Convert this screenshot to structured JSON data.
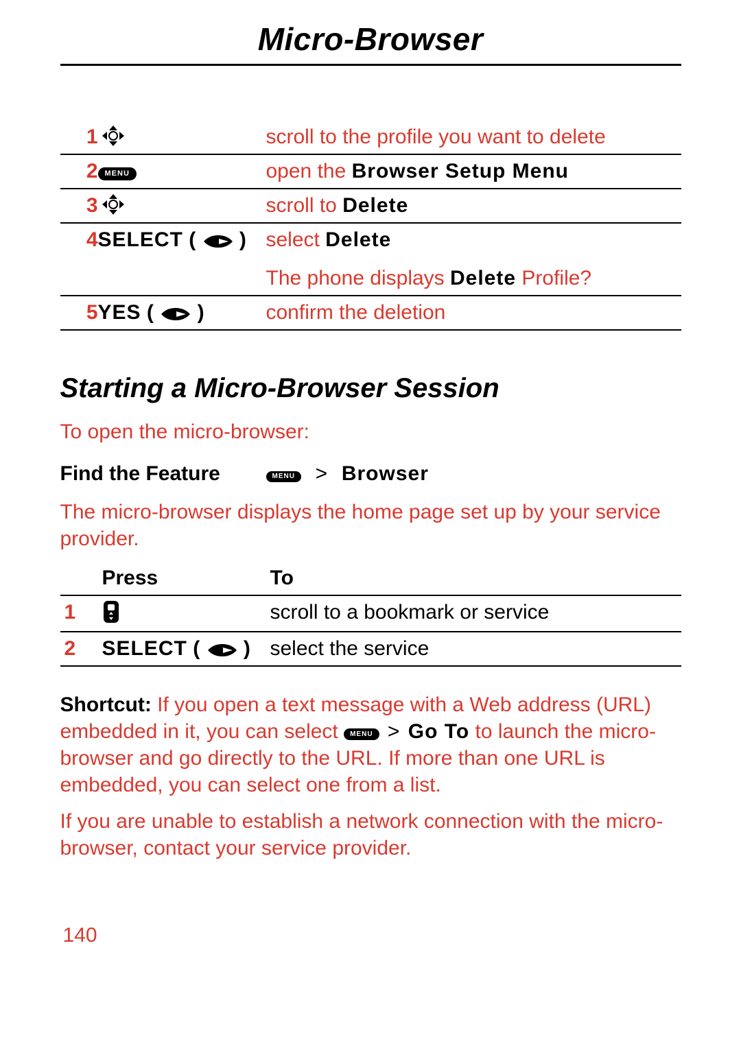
{
  "title": "Micro-Browser",
  "table1": {
    "rows": [
      {
        "num": "1",
        "icon": "nav",
        "press_text": "",
        "to": "scroll to the profile you want to delete"
      },
      {
        "num": "2",
        "icon": "menu",
        "press_text": "",
        "to_pre": "open the ",
        "to_mono": "Browser Setup Menu",
        "to_post": ""
      },
      {
        "num": "3",
        "icon": "nav",
        "press_text": "",
        "to_pre": "scroll to ",
        "to_mono": "Delete",
        "to_post": ""
      },
      {
        "num": "4",
        "icon": "select",
        "press_text": "SELECT",
        "to_pre": "select ",
        "to_mono": "Delete",
        "to_post": ""
      },
      {
        "num": "",
        "icon": "",
        "press_text": "",
        "to_pre": "The phone displays ",
        "to_mono": "Delete",
        "to_post": " Profile?"
      },
      {
        "num": "5",
        "icon": "select",
        "press_text": "YES",
        "to": "confirm the deletion"
      }
    ]
  },
  "section_heading": "Starting a Micro-Browser Session",
  "intro": "To open the micro-browser:",
  "feature": {
    "label": "Find the Feature",
    "path_item": "Browser"
  },
  "para1": "The micro-browser displays the home page set up by your service provider.",
  "table2": {
    "press_header": "Press",
    "to_header": "To",
    "rows": [
      {
        "num": "1",
        "icon": "phone",
        "press_text": "",
        "to": "scroll to a bookmark or service"
      },
      {
        "num": "2",
        "icon": "select",
        "press_text": "SELECT",
        "to": "select the service"
      }
    ]
  },
  "shortcut": {
    "label": "Shortcut:",
    "pre": " If you open a text message with a Web address (URL) embedded in it, you can select ",
    "path_item": "Go To",
    "post": " to launch the micro-browser and go directly to the URL. If more than one URL is embedded, you can select one from a list."
  },
  "para3": "If you are unable to establish a network connection with the micro-browser, contact your service provider.",
  "page_number": "140"
}
